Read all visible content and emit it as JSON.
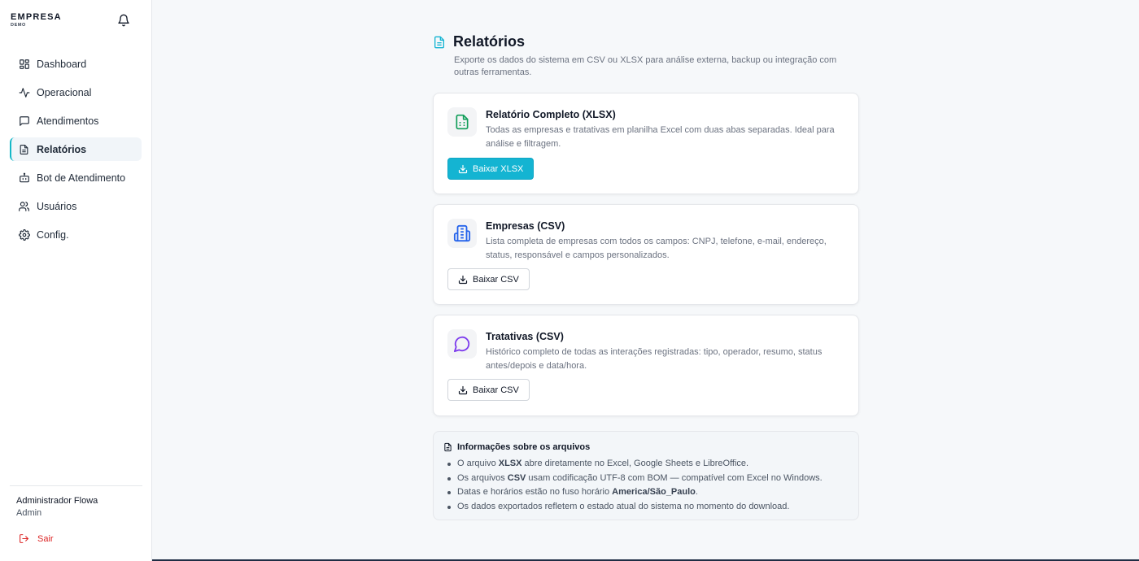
{
  "brand": {
    "name": "EMPRESA",
    "sub": "DEMO"
  },
  "sidebar": {
    "items": [
      {
        "label": "Dashboard",
        "icon": "dashboard-icon",
        "active": false
      },
      {
        "label": "Operacional",
        "icon": "activity-icon",
        "active": false
      },
      {
        "label": "Atendimentos",
        "icon": "message-square-icon",
        "active": false
      },
      {
        "label": "Relatórios",
        "icon": "file-text-icon",
        "active": true
      },
      {
        "label": "Bot de Atendimento",
        "icon": "bot-icon",
        "active": false
      },
      {
        "label": "Usuários",
        "icon": "users-icon",
        "active": false
      },
      {
        "label": "Config.",
        "icon": "gear-icon",
        "active": false
      }
    ],
    "user": {
      "name": "Administrador Flowa",
      "role": "Admin"
    },
    "logout_label": "Sair"
  },
  "page": {
    "title": "Relatórios",
    "description": "Exporte os dados do sistema em CSV ou XLSX para análise externa, backup ou integração com outras ferramentas."
  },
  "cards": [
    {
      "title": "Relatório Completo (XLSX)",
      "description": "Todas as empresas e tratativas em planilha Excel com duas abas separadas. Ideal para análise e filtragem.",
      "button": "Baixar XLSX",
      "icon": "spreadsheet-icon"
    },
    {
      "title": "Empresas (CSV)",
      "description": "Lista completa de empresas com todos os campos: CNPJ, telefone, e-mail, endereço, status, responsável e campos personalizados.",
      "button": "Baixar CSV",
      "icon": "building-icon"
    },
    {
      "title": "Tratativas (CSV)",
      "description": "Histórico completo de todas as interações registradas: tipo, operador, resumo, status antes/depois e data/hora.",
      "button": "Baixar CSV",
      "icon": "chat-bubble-icon"
    }
  ],
  "info": {
    "title": "Informações sobre os arquivos",
    "items": [
      {
        "pre": "O arquivo ",
        "bold": "XLSX",
        "post": " abre diretamente no Excel, Google Sheets e LibreOffice."
      },
      {
        "pre": "Os arquivos ",
        "bold": "CSV",
        "post": " usam codificação UTF-8 com BOM — compatível com Excel no Windows."
      },
      {
        "pre": "Datas e horários estão no fuso horário ",
        "bold": "America/São_Paulo",
        "post": "."
      },
      {
        "pre": "Os dados exportados refletem o estado atual do sistema no momento do download.",
        "bold": "",
        "post": ""
      }
    ]
  },
  "colors": {
    "accent": "#14b4d2",
    "xlsx_icon": "#0f9d58",
    "building_icon": "#2563eb",
    "chat_icon": "#7c3aed",
    "logout": "#dc2626"
  }
}
